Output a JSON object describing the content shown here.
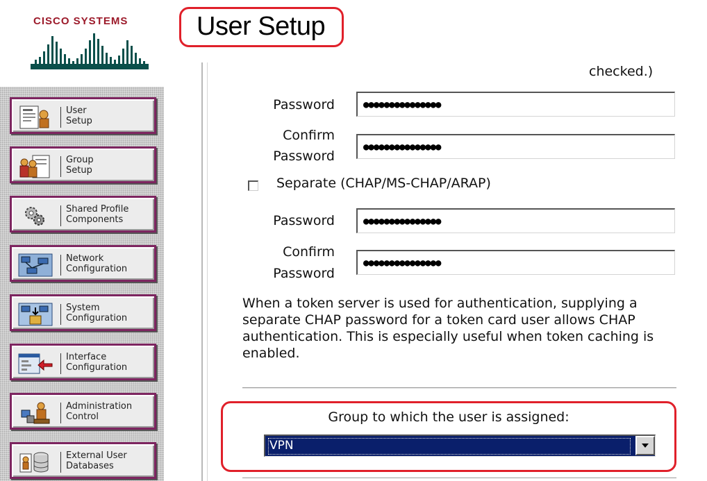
{
  "brand": {
    "logo_text": "Cisco Systems",
    "accent": "#9c1a2a"
  },
  "page": {
    "title": "User Setup"
  },
  "nav": {
    "items": [
      {
        "label": "User\nSetup",
        "icon": "user-setup-icon"
      },
      {
        "label": "Group\nSetup",
        "icon": "group-setup-icon"
      },
      {
        "label": "Shared Profile\nComponents",
        "icon": "shared-profile-components-icon"
      },
      {
        "label": "Network\nConfiguration",
        "icon": "network-configuration-icon"
      },
      {
        "label": "System\nConfiguration",
        "icon": "system-configuration-icon"
      },
      {
        "label": "Interface\nConfiguration",
        "icon": "interface-configuration-icon"
      },
      {
        "label": "Administration\nControl",
        "icon": "administration-control-icon"
      },
      {
        "label": "External User\nDatabases",
        "icon": "external-user-databases-icon"
      }
    ]
  },
  "form": {
    "checked_fragment": "checked.)",
    "password_label": "Password",
    "confirm_label_line1": "Confirm",
    "confirm_label_line2": "Password",
    "password_value": "●●●●●●●●●●●●●●●",
    "confirm_value": "●●●●●●●●●●●●●●●",
    "separate_label": "Separate (CHAP/MS-CHAP/ARAP)",
    "separate_checked": false,
    "chap_password_value": "●●●●●●●●●●●●●●●",
    "chap_confirm_value": "●●●●●●●●●●●●●●●",
    "token_note": "When a token server is used for authentication, supplying a separate CHAP password for a token card user allows CHAP authentication. This is especially useful when token caching is enabled.",
    "group_label": "Group to which the user is assigned:",
    "group_selected": "VPN"
  },
  "highlight_color": "#e0202a"
}
